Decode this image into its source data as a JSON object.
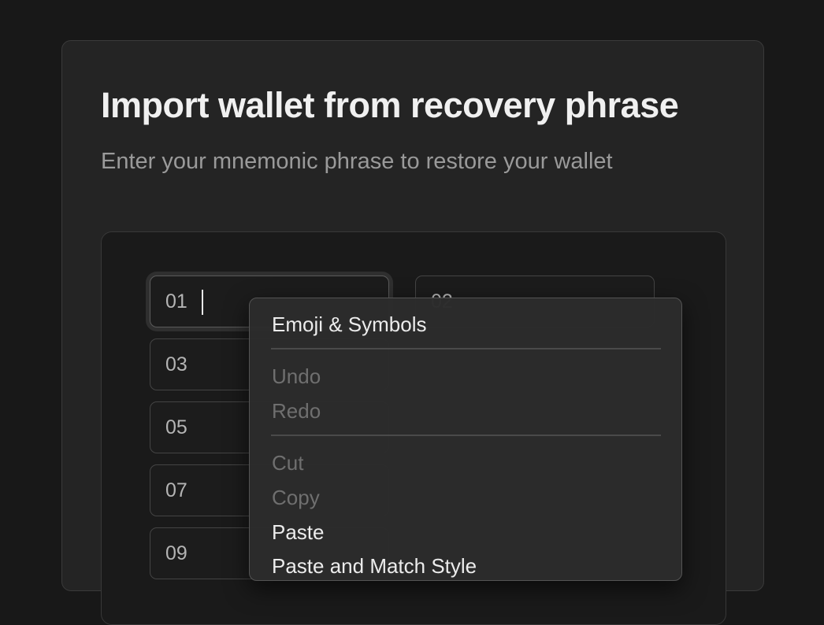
{
  "page": {
    "title": "Import wallet from recovery phrase",
    "subtitle": "Enter your mnemonic phrase to restore your wallet"
  },
  "phrase_fields": [
    {
      "number": "01",
      "value": "",
      "focused": true
    },
    {
      "number": "02",
      "value": ""
    },
    {
      "number": "03",
      "value": ""
    },
    {
      "number": "05",
      "value": ""
    },
    {
      "number": "07",
      "value": ""
    },
    {
      "number": "09",
      "value": ""
    }
  ],
  "context_menu": {
    "items": [
      {
        "label": "Emoji & Symbols",
        "enabled": true
      },
      {
        "label": "Undo",
        "enabled": false
      },
      {
        "label": "Redo",
        "enabled": false
      },
      {
        "label": "Cut",
        "enabled": false
      },
      {
        "label": "Copy",
        "enabled": false
      },
      {
        "label": "Paste",
        "enabled": true
      },
      {
        "label": "Paste and Match Style",
        "enabled": true
      }
    ]
  },
  "colors": {
    "background": "#181818",
    "card": "#242424",
    "panel": "#1a1a1a",
    "text_primary": "#f0f0f0",
    "text_secondary": "#9a9a9a",
    "menu_background": "#2c2c2c",
    "menu_disabled_text": "#6f6f6f"
  }
}
